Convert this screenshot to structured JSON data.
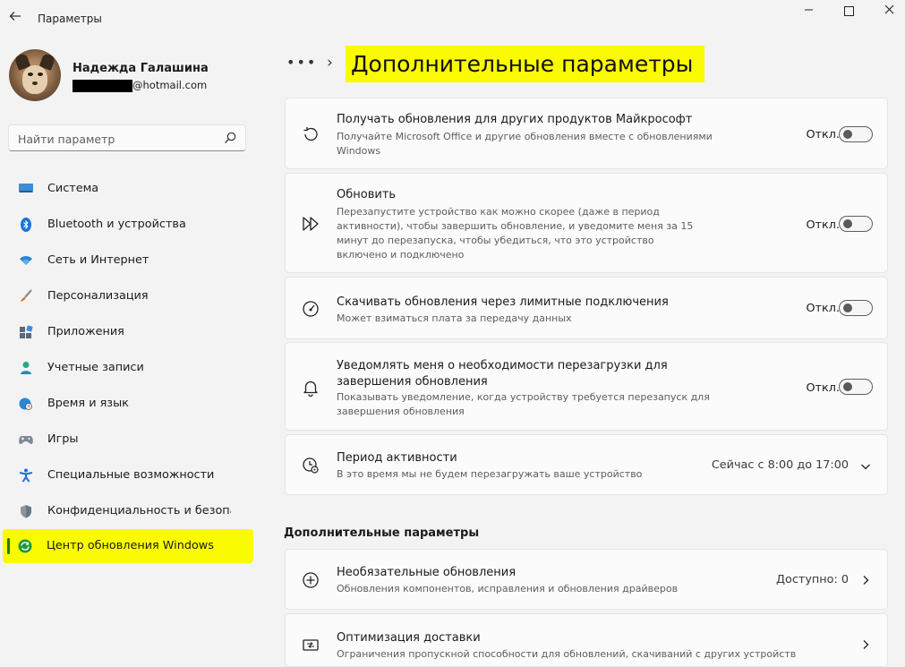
{
  "window": {
    "title": "Параметры",
    "controls": {
      "minimize": "—"
    }
  },
  "profile": {
    "name": "Надежда Галашина",
    "email_domain": "@hotmail.com"
  },
  "search": {
    "placeholder": "Найти параметр"
  },
  "sidebar": {
    "items": [
      {
        "label": "Система",
        "icon": "monitor-icon"
      },
      {
        "label": "Bluetooth и устройства",
        "icon": "bluetooth-icon"
      },
      {
        "label": "Сеть и Интернет",
        "icon": "wifi-icon"
      },
      {
        "label": "Персонализация",
        "icon": "brush-icon"
      },
      {
        "label": "Приложения",
        "icon": "apps-icon"
      },
      {
        "label": "Учетные записи",
        "icon": "person-icon"
      },
      {
        "label": "Время и язык",
        "icon": "globe-clock-icon"
      },
      {
        "label": "Игры",
        "icon": "gamepad-icon"
      },
      {
        "label": "Специальные возможности",
        "icon": "accessibility-icon"
      },
      {
        "label": "Конфиденциальность и безопасность",
        "icon": "shield-icon"
      },
      {
        "label": "Центр обновления Windows",
        "icon": "update-icon",
        "active": true
      }
    ]
  },
  "header": {
    "breadcrumb_more": "•••",
    "breadcrumb_separator": "›",
    "title": "Дополнительные параметры"
  },
  "settings": [
    {
      "title": "Получать обновления для других продуктов Майкрософт",
      "desc": "Получайте Microsoft Office и другие обновления вместе с обновлениями Windows",
      "state": "Откл.",
      "icon": "history-icon"
    },
    {
      "title": "Обновить",
      "desc": "Перезапустите устройство как можно скорее (даже в период активности), чтобы завершить обновление, и уведомите меня за 15 минут до перезапуска, чтобы убедиться, что это устройство включено и подключено",
      "state": "Откл.",
      "icon": "fast-forward-icon"
    },
    {
      "title": "Скачивать обновления через лимитные подключения",
      "desc": "Может взиматься плата за передачу данных",
      "state": "Откл.",
      "icon": "gauge-icon"
    },
    {
      "title": "Уведомлять меня о необходимости перезагрузки для завершения обновления",
      "desc": "Показывать уведомление, когда устройству требуется перезапуск для завершения обновления",
      "state": "Откл.",
      "icon": "bell-icon"
    },
    {
      "title": "Период активности",
      "desc": "В это время мы не будем перезагружать ваше устройство",
      "value": "Сейчас с 8:00 до 17:00",
      "icon": "clock-gear-icon"
    }
  ],
  "additional": {
    "section_title": "Дополнительные параметры",
    "items": [
      {
        "title": "Необязательные обновления",
        "desc": "Обновления компонентов, исправления и обновления драйверов",
        "value": "Доступно: 0",
        "icon": "plus-circle-icon"
      },
      {
        "title": "Оптимизация доставки",
        "desc": "Ограничения пропускной способности для обновлений, скачиваний с других устройств",
        "icon": "delivery-icon"
      }
    ]
  },
  "colors": {
    "highlight": "#fbfb00",
    "background": "#f3f3f3",
    "card": "#fbfbfb",
    "active_indicator": "#1a7a1a"
  }
}
